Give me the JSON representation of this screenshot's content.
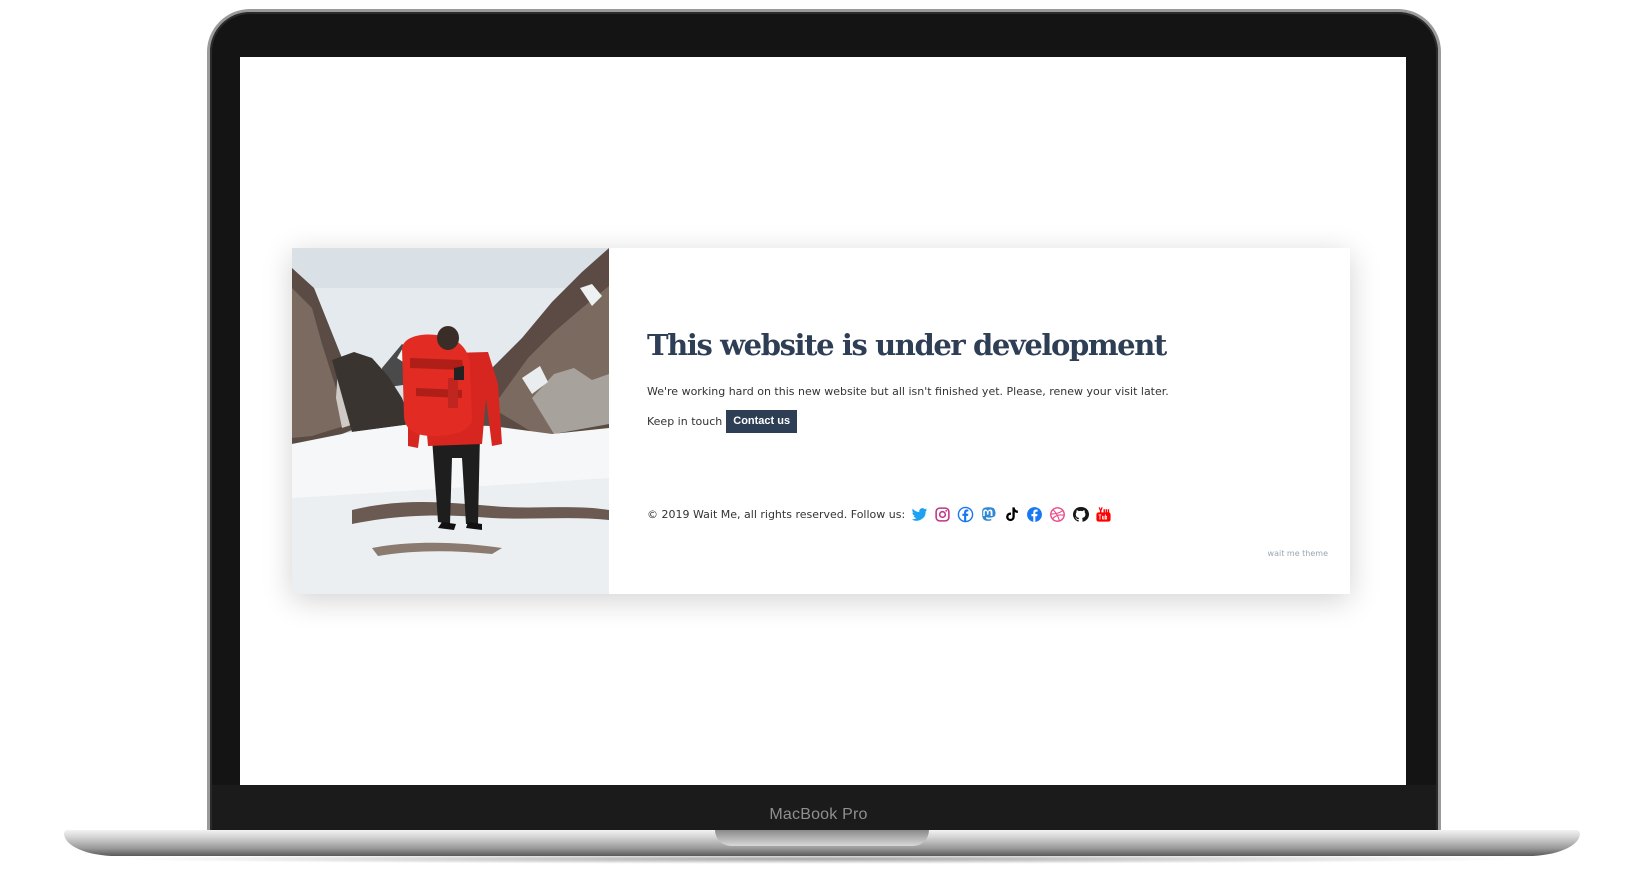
{
  "device": {
    "brand_label": "MacBook Pro"
  },
  "page": {
    "title": "This website is under development",
    "lead": "We're working hard on this new website but all isn't finished yet. Please, renew your visit later.",
    "touch_label": "Keep in touch",
    "contact_button": "Contact us",
    "copyright": "© 2019 Wait Me, all rights reserved. Follow us:",
    "theme_credit": "wait me theme",
    "colors": {
      "accent": "#2e3e55",
      "twitter": "#1da1f2",
      "instagram": "#c13584",
      "facebook": "#1877f2",
      "mastodon": "#3088d4",
      "tiktok": "#000000",
      "dribbble": "#ea4c89",
      "github": "#181717",
      "youtube": "#ff0000"
    },
    "social_icons": [
      "twitter-icon",
      "instagram-icon",
      "facebook-icon",
      "mastodon-icon",
      "tiktok-icon",
      "facebook-icon",
      "dribbble-icon",
      "github-icon",
      "youtube-icon"
    ]
  }
}
